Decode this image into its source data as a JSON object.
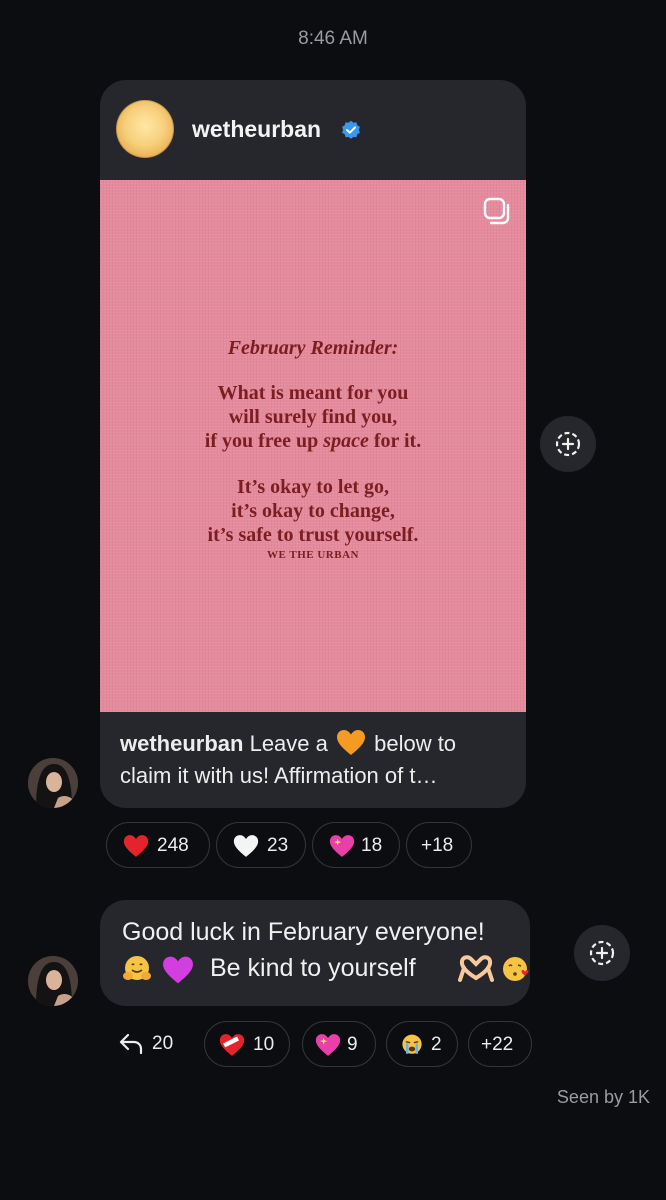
{
  "timestamp": "8:46 AM",
  "post": {
    "username": "wetheurban",
    "image_lines": {
      "title": "February Reminder:",
      "line1": "What is meant for you",
      "line2": "will surely find you,",
      "line3_pre": "if you free up ",
      "line3_em": "space",
      "line3_post": " for it.",
      "line4": "It’s okay to let go,",
      "line5": "it’s okay to change,",
      "line6": "it’s safe to trust yourself.",
      "brand": "WE THE URBAN"
    },
    "caption_user": "wetheurban",
    "caption_pre": " Leave a ",
    "caption_post": " below to",
    "caption_line2": "claim it with us! Affirmation of t…",
    "caption_emoji": "orange-heart-icon"
  },
  "post_reactions": [
    {
      "emoji": "red-heart-icon",
      "count": "248"
    },
    {
      "emoji": "white-heart-icon",
      "count": "23"
    },
    {
      "emoji": "sparkling-heart-icon",
      "count": "18"
    },
    {
      "emoji": "",
      "count": "+18"
    }
  ],
  "message": {
    "line1": "Good luck in February everyone!",
    "line2_text": "Be kind to yourself",
    "emojis": [
      "hugging-face-icon",
      "purple-heart-icon",
      "heart-hands-icon",
      "face-blowing-kiss-icon"
    ]
  },
  "message_reactions": [
    {
      "emoji": "reply-icon",
      "count": "20"
    },
    {
      "emoji": "mending-heart-icon",
      "count": "10"
    },
    {
      "emoji": "sparkling-heart-icon",
      "count": "9"
    },
    {
      "emoji": "loudly-crying-face-icon",
      "count": "2"
    },
    {
      "emoji": "",
      "count": "+22"
    }
  ],
  "seen": "Seen by 1K",
  "colors": {
    "background": "#0c0d10",
    "bubble": "#26272c",
    "post_pink": "#e48b9d",
    "post_text": "#7a1e22",
    "verified_blue": "#3897f0"
  }
}
